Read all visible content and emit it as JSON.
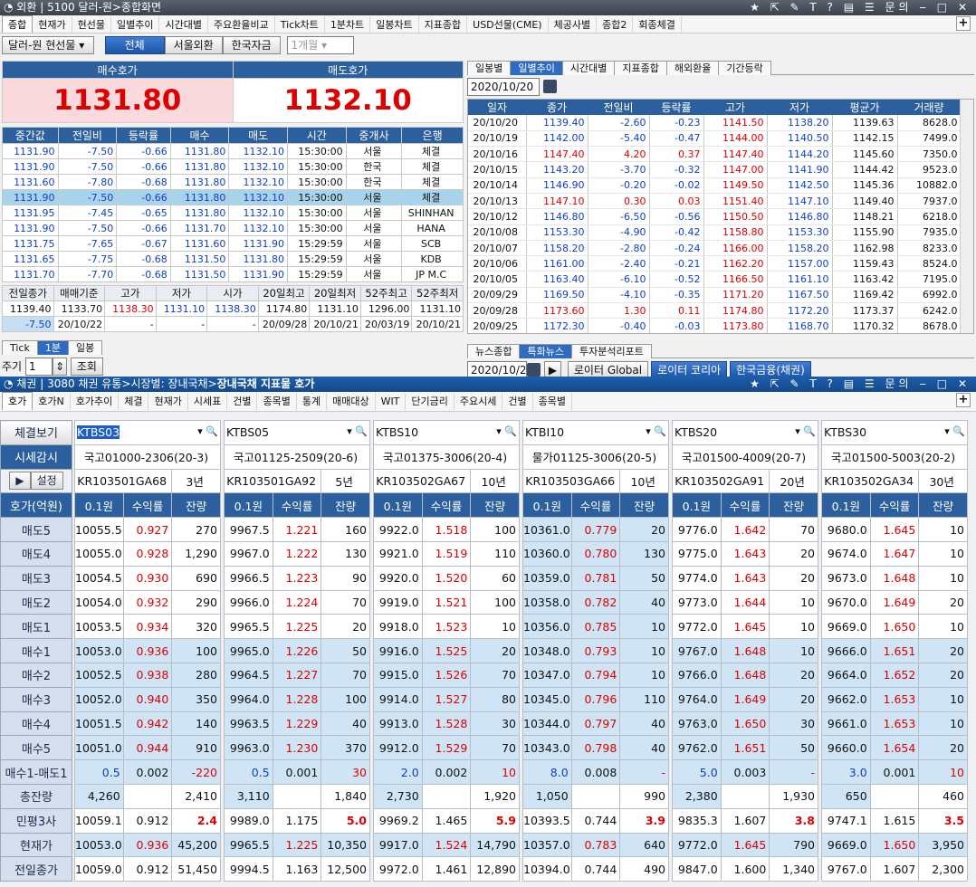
{
  "w1": {
    "title": "외환",
    "title2": "5100 달러-원>종합화면",
    "tr_icons": "★ ⇱ ✎ T ? ▤ ☰ 문의 ‒ □ ✕",
    "menus": [
      "종합",
      "현재가",
      "현선물",
      "일별추이",
      "시간대별",
      "주요환율비교",
      "Tick차트",
      "1분차트",
      "일봉차트",
      "지표종합",
      "USD선물(CME)",
      "체공사별",
      "종합2",
      "회종체결"
    ],
    "selector": "달러-원 현선물",
    "seg": [
      "전체",
      "서울외환",
      "한국자금"
    ],
    "period": "1개월",
    "bid_label": "매수호가",
    "ask_label": "매도호가",
    "bid": "1131.80",
    "ask": "1132.10",
    "tick_headers": [
      "중간값",
      "전일비",
      "등락률",
      "매수",
      "매도",
      "시간",
      "중개사",
      "은행"
    ],
    "ticks": [
      [
        "1131.90",
        "-7.50",
        "-0.66",
        "1131.80",
        "1132.10",
        "15:30:00",
        "서울",
        "체결"
      ],
      [
        "1131.90",
        "-7.50",
        "-0.66",
        "1131.80",
        "1132.10",
        "15:30:00",
        "한국",
        "체결"
      ],
      [
        "1131.60",
        "-7.80",
        "-0.68",
        "1131.80",
        "1132.10",
        "15:30:00",
        "한국",
        "체결"
      ],
      [
        "1131.90",
        "-7.50",
        "-0.66",
        "1131.80",
        "1132.10",
        "15:30:00",
        "서울",
        "체결"
      ],
      [
        "1131.95",
        "-7.45",
        "-0.65",
        "1131.80",
        "1132.10",
        "15:30:00",
        "서울",
        "SHINHAN"
      ],
      [
        "1131.90",
        "-7.50",
        "-0.66",
        "1131.70",
        "1132.10",
        "15:30:00",
        "서울",
        "HANA"
      ],
      [
        "1131.75",
        "-7.65",
        "-0.67",
        "1131.60",
        "1131.90",
        "15:29:59",
        "서울",
        "SCB"
      ],
      [
        "1131.65",
        "-7.75",
        "-0.68",
        "1131.50",
        "1131.80",
        "15:29:59",
        "서울",
        "KDB"
      ],
      [
        "1131.70",
        "-7.70",
        "-0.68",
        "1131.50",
        "1131.90",
        "15:29:59",
        "서울",
        "JP M.C"
      ]
    ],
    "sum_headers": [
      "전일종가",
      "매매기준",
      "고가",
      "저가",
      "시가",
      "20일최고",
      "20일최저",
      "52주최고",
      "52주최저"
    ],
    "sum_row1": [
      "1139.40",
      "1133.70",
      "1138.30",
      "1131.10",
      "1138.30",
      "1174.80",
      "1131.10",
      "1296.00",
      "1131.10"
    ],
    "sum_row2": [
      "-7.50",
      "20/10/22",
      "-",
      "-",
      "-",
      "20/09/28",
      "20/10/21",
      "20/03/19",
      "20/10/21"
    ],
    "btabs": [
      "Tick",
      "1분",
      "일봉"
    ],
    "cycle_label": "주기",
    "cycle_value": "1",
    "query": "조회",
    "rtabs": [
      "일봉별",
      "일별추이",
      "시간대별",
      "지표종합",
      "해외환율",
      "기간등락"
    ],
    "rdate": "2020/10/20",
    "daily_headers": [
      "일자",
      "종가",
      "전일비",
      "등락률",
      "고가",
      "저가",
      "평균가",
      "거래량"
    ],
    "daily": [
      [
        "20/10/20",
        "1139.40",
        "-2.60",
        "-0.23",
        "1141.50",
        "1138.20",
        "1139.63",
        "8628.0"
      ],
      [
        "20/10/19",
        "1142.00",
        "-5.40",
        "-0.47",
        "1144.00",
        "1140.50",
        "1142.15",
        "7499.0"
      ],
      [
        "20/10/16",
        "1147.40",
        "4.20",
        "0.37",
        "1147.40",
        "1144.20",
        "1145.60",
        "7350.0"
      ],
      [
        "20/10/15",
        "1143.20",
        "-3.70",
        "-0.32",
        "1147.00",
        "1141.90",
        "1144.42",
        "9523.0"
      ],
      [
        "20/10/14",
        "1146.90",
        "-0.20",
        "-0.02",
        "1149.50",
        "1142.50",
        "1145.36",
        "10882.0"
      ],
      [
        "20/10/13",
        "1147.10",
        "0.30",
        "0.03",
        "1151.40",
        "1147.10",
        "1149.40",
        "7937.0"
      ],
      [
        "20/10/12",
        "1146.80",
        "-6.50",
        "-0.56",
        "1150.50",
        "1146.80",
        "1148.21",
        "6218.0"
      ],
      [
        "20/10/08",
        "1153.30",
        "-4.90",
        "-0.42",
        "1158.80",
        "1153.30",
        "1155.90",
        "7935.0"
      ],
      [
        "20/10/07",
        "1158.20",
        "-2.80",
        "-0.24",
        "1166.00",
        "1158.20",
        "1162.98",
        "8233.0"
      ],
      [
        "20/10/06",
        "1161.00",
        "-2.40",
        "-0.21",
        "1162.20",
        "1157.00",
        "1159.43",
        "8524.0"
      ],
      [
        "20/10/05",
        "1163.40",
        "-6.10",
        "-0.52",
        "1166.50",
        "1161.10",
        "1163.42",
        "7195.0"
      ],
      [
        "20/09/29",
        "1169.50",
        "-4.10",
        "-0.35",
        "1171.20",
        "1167.50",
        "1169.42",
        "6992.0"
      ],
      [
        "20/09/28",
        "1173.60",
        "1.30",
        "0.11",
        "1174.80",
        "1172.20",
        "1173.37",
        "6242.0"
      ],
      [
        "20/09/25",
        "1172.30",
        "-0.40",
        "-0.03",
        "1173.80",
        "1168.70",
        "1170.32",
        "8678.0"
      ]
    ],
    "ntabs": [
      "뉴스종합",
      "특화뉴스",
      "투자분석리포트"
    ],
    "ndate": "2020/10/21",
    "nbtns": [
      "로이터 Global",
      "로이터 코리아",
      "한국금융(채권)"
    ]
  },
  "w2": {
    "title": "채권",
    "title2": "3080 채권 유통>시장별: 장내국채>",
    "title3": "장내국채 지표물 호가",
    "menus": [
      "호가",
      "호가N",
      "호가추이",
      "체결",
      "현재가",
      "시세표",
      "건별",
      "종목별",
      "통계",
      "매매대상",
      "WIT",
      "단기금리",
      "주요시세",
      "건별",
      "종목별"
    ],
    "left_btns": [
      "체결보기",
      "시세감시",
      "▶",
      "설정"
    ],
    "row_labels": [
      "호가(억원)",
      "매도5",
      "매도4",
      "매도3",
      "매도2",
      "매도1",
      "매수1",
      "매수2",
      "매수3",
      "매수4",
      "매수5",
      "매수1-매도1",
      "총잔량",
      "민평3사",
      "현재가",
      "전일종가"
    ],
    "subheads": [
      "0.1원",
      "수익률",
      "잔량"
    ],
    "bonds": [
      {
        "code": "KTBS03",
        "name": "국고01000-2306(20-3)",
        "isin": "KR103501GA68",
        "term": "3년",
        "rows": [
          [
            "10055.5",
            "0.927",
            "270"
          ],
          [
            "10055.0",
            "0.928",
            "1,290"
          ],
          [
            "10054.5",
            "0.930",
            "690"
          ],
          [
            "10054.0",
            "0.932",
            "290"
          ],
          [
            "10053.5",
            "0.934",
            "320"
          ],
          [
            "10053.0",
            "0.936",
            "100"
          ],
          [
            "10052.5",
            "0.938",
            "280"
          ],
          [
            "10052.0",
            "0.940",
            "350"
          ],
          [
            "10051.5",
            "0.942",
            "140"
          ],
          [
            "10051.0",
            "0.944",
            "910"
          ],
          [
            "0.5",
            "0.002",
            "-220"
          ],
          [
            "4,260",
            "",
            "2,410"
          ],
          [
            "10059.1",
            "0.912",
            "2.4"
          ],
          [
            "10053.0",
            "0.936",
            "45,200"
          ],
          [
            "10059.0",
            "0.912",
            "51,450"
          ]
        ]
      },
      {
        "code": "KTBS05",
        "name": "국고01125-2509(20-6)",
        "isin": "KR103501GA92",
        "term": "5년",
        "rows": [
          [
            "9967.5",
            "1.221",
            "160"
          ],
          [
            "9967.0",
            "1.222",
            "130"
          ],
          [
            "9966.5",
            "1.223",
            "90"
          ],
          [
            "9966.0",
            "1.224",
            "70"
          ],
          [
            "9965.5",
            "1.225",
            "20"
          ],
          [
            "9965.0",
            "1.226",
            "50"
          ],
          [
            "9964.5",
            "1.227",
            "70"
          ],
          [
            "9964.0",
            "1.228",
            "100"
          ],
          [
            "9963.5",
            "1.229",
            "40"
          ],
          [
            "9963.0",
            "1.230",
            "370"
          ],
          [
            "0.5",
            "0.001",
            "30"
          ],
          [
            "3,110",
            "",
            "1,840"
          ],
          [
            "9989.0",
            "1.175",
            "5.0"
          ],
          [
            "9965.5",
            "1.225",
            "10,350"
          ],
          [
            "9994.5",
            "1.163",
            "12,500"
          ]
        ]
      },
      {
        "code": "KTBS10",
        "name": "국고01375-3006(20-4)",
        "isin": "KR103502GA67",
        "term": "10년",
        "rows": [
          [
            "9922.0",
            "1.518",
            "100"
          ],
          [
            "9921.0",
            "1.519",
            "110"
          ],
          [
            "9920.0",
            "1.520",
            "60"
          ],
          [
            "9919.0",
            "1.521",
            "100"
          ],
          [
            "9918.0",
            "1.523",
            "10"
          ],
          [
            "9916.0",
            "1.525",
            "20"
          ],
          [
            "9915.0",
            "1.526",
            "70"
          ],
          [
            "9914.0",
            "1.527",
            "80"
          ],
          [
            "9913.0",
            "1.528",
            "30"
          ],
          [
            "9912.0",
            "1.529",
            "70"
          ],
          [
            "2.0",
            "0.002",
            "10"
          ],
          [
            "2,730",
            "",
            "1,920"
          ],
          [
            "9969.2",
            "1.465",
            "5.9"
          ],
          [
            "9917.0",
            "1.524",
            "14,790"
          ],
          [
            "9972.0",
            "1.461",
            "12,890"
          ]
        ]
      },
      {
        "code": "KTBI10",
        "name": "물가01125-3006(20-5)",
        "isin": "KR103503GA66",
        "term": "10년",
        "rows": [
          [
            "10361.0",
            "0.779",
            "20"
          ],
          [
            "10360.0",
            "0.780",
            "130"
          ],
          [
            "10359.0",
            "0.781",
            "50"
          ],
          [
            "10358.0",
            "0.782",
            "40"
          ],
          [
            "10356.0",
            "0.785",
            "10"
          ],
          [
            "10348.0",
            "0.793",
            "10"
          ],
          [
            "10347.0",
            "0.794",
            "10"
          ],
          [
            "10345.0",
            "0.796",
            "110"
          ],
          [
            "10344.0",
            "0.797",
            "40"
          ],
          [
            "10343.0",
            "0.798",
            "40"
          ],
          [
            "8.0",
            "0.008",
            "-"
          ],
          [
            "1,050",
            "",
            "990"
          ],
          [
            "10393.5",
            "0.744",
            "3.9"
          ],
          [
            "10357.0",
            "0.783",
            "640"
          ],
          [
            "10394.0",
            "0.744",
            "490"
          ]
        ]
      },
      {
        "code": "KTBS20",
        "name": "국고01500-4009(20-7)",
        "isin": "KR103502GA91",
        "term": "20년",
        "rows": [
          [
            "9776.0",
            "1.642",
            "70"
          ],
          [
            "9775.0",
            "1.643",
            "20"
          ],
          [
            "9774.0",
            "1.643",
            "20"
          ],
          [
            "9773.0",
            "1.644",
            "10"
          ],
          [
            "9772.0",
            "1.645",
            "10"
          ],
          [
            "9767.0",
            "1.648",
            "10"
          ],
          [
            "9766.0",
            "1.648",
            "20"
          ],
          [
            "9764.0",
            "1.649",
            "20"
          ],
          [
            "9763.0",
            "1.650",
            "30"
          ],
          [
            "9762.0",
            "1.651",
            "50"
          ],
          [
            "5.0",
            "0.003",
            "-"
          ],
          [
            "2,380",
            "",
            "1,930"
          ],
          [
            "9835.3",
            "1.607",
            "3.8"
          ],
          [
            "9772.0",
            "1.645",
            "790"
          ],
          [
            "9847.0",
            "1.600",
            "1,340"
          ]
        ]
      },
      {
        "code": "KTBS30",
        "name": "국고01500-5003(20-2)",
        "isin": "KR103502GA34",
        "term": "30년",
        "rows": [
          [
            "9680.0",
            "1.645",
            "10"
          ],
          [
            "9674.0",
            "1.647",
            "10"
          ],
          [
            "9673.0",
            "1.648",
            "10"
          ],
          [
            "9670.0",
            "1.649",
            "20"
          ],
          [
            "9669.0",
            "1.650",
            "10"
          ],
          [
            "9666.0",
            "1.651",
            "20"
          ],
          [
            "9664.0",
            "1.652",
            "20"
          ],
          [
            "9662.0",
            "1.653",
            "10"
          ],
          [
            "9661.0",
            "1.653",
            "10"
          ],
          [
            "9660.0",
            "1.654",
            "20"
          ],
          [
            "3.0",
            "0.001",
            "10"
          ],
          [
            "650",
            "",
            "460"
          ],
          [
            "9747.1",
            "1.615",
            "3.5"
          ],
          [
            "9669.0",
            "1.650",
            "3,950"
          ],
          [
            "9767.0",
            "1.607",
            "2,300"
          ]
        ]
      }
    ]
  }
}
